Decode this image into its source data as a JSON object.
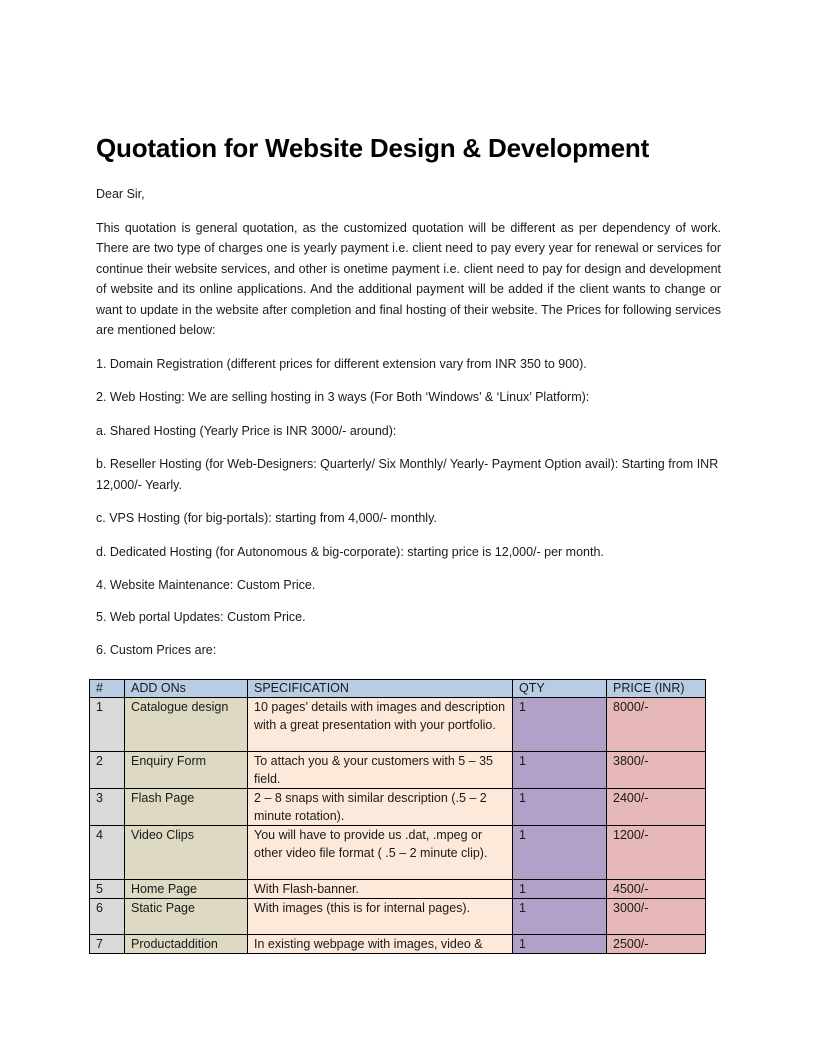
{
  "title": "Quotation for Website Design & Development",
  "greeting": "Dear Sir,",
  "intro": "This quotation is general quotation, as the customized quotation will be different as per dependency of work. There are two type of charges one is yearly payment i.e. client need to pay every year for renewal or services for continue their website services, and other is onetime payment i.e. client need to pay for design and development of website and its online applications. And the additional payment will be added if the client wants to change or want to update in the website after completion and final hosting of their website. The Prices for following services are mentioned below:",
  "items": {
    "domain": "1. Domain Registration (different prices for different extension vary from INR 350 to 900).",
    "hosting": "2. Web Hosting: We are selling hosting in 3 ways (For Both ‘Windows’ & ‘Linux’ Platform):",
    "shared": "a. Shared Hosting (Yearly Price is INR 3000/- around):",
    "reseller": "b. Reseller Hosting (for Web-Designers:  Quarterly/ Six Monthly/ Yearly- Payment Option avail): Starting from INR 12,000/-  Yearly.",
    "vps": "c. VPS Hosting (for big-portals): starting from 4,000/-  monthly.",
    "dedicated": "d. Dedicated Hosting (for Autonomous & big-corporate): starting price is 12,000/-  per month.",
    "maintenance": "4. Website Maintenance: Custom Price.",
    "updates": "5. Web portal Updates: Custom Price.",
    "custom": "6. Custom Prices are:"
  },
  "table": {
    "headers": [
      "#",
      "ADD ONs",
      "SPECIFICATION",
      "QTY",
      "PRICE (INR)"
    ],
    "rows": [
      {
        "num": "1",
        "addon": "Catalogue design",
        "spec": "10  pages’ details with images and description with a great presentation with your portfolio.",
        "qty": "1",
        "price": "8000/-"
      },
      {
        "num": "2",
        "addon": "Enquiry Form",
        "spec": "To attach you & your customers with 5 – 35 field.",
        "qty": "1",
        "price": "3800/-"
      },
      {
        "num": "3",
        "addon": "Flash Page",
        "spec": "2 – 8 snaps with similar description (.5 – 2 minute rotation).",
        "qty": "1",
        "price": "2400/-"
      },
      {
        "num": "4",
        "addon": "Video Clips",
        "spec": "You will have to provide us .dat, .mpeg or other video file format ( .5 – 2 minute clip).",
        "qty": "1",
        "price": "1200/-"
      },
      {
        "num": "5",
        "addon": "Home Page",
        "spec": "With Flash-banner.",
        "qty": "1",
        "price": "4500/-"
      },
      {
        "num": "6",
        "addon": "Static Page",
        "spec": "With images (this is for internal pages).",
        "qty": "1",
        "price": "3000/-"
      },
      {
        "num": "7",
        "addon": "Productaddition",
        "spec": "In existing webpage with images, video &",
        "qty": "1",
        "price": "2500/-"
      }
    ]
  }
}
